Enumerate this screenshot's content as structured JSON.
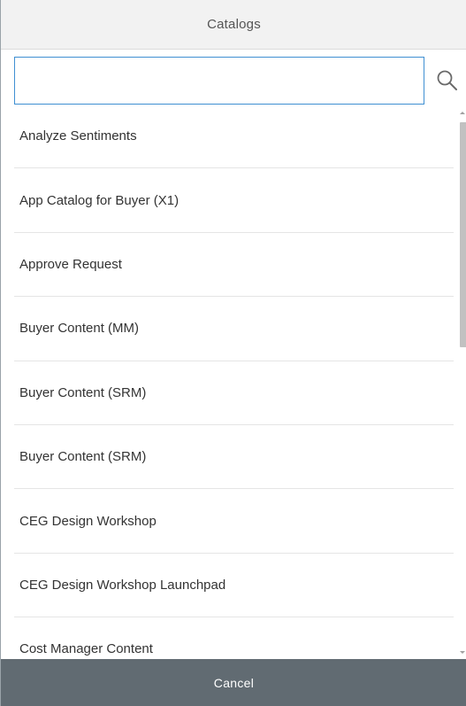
{
  "dialog": {
    "title": "Catalogs"
  },
  "search": {
    "value": "",
    "placeholder": "",
    "icon": "search-icon"
  },
  "catalogs": {
    "items": [
      {
        "label": "Analyze Sentiments"
      },
      {
        "label": "App Catalog for Buyer (X1)"
      },
      {
        "label": "Approve Request"
      },
      {
        "label": "Buyer Content (MM)"
      },
      {
        "label": "Buyer Content (SRM)"
      },
      {
        "label": "Buyer Content (SRM)"
      },
      {
        "label": "CEG Design Workshop"
      },
      {
        "label": "CEG Design Workshop Launchpad"
      },
      {
        "label": "Cost Manager Content"
      }
    ]
  },
  "footer": {
    "cancel_label": "Cancel"
  },
  "colors": {
    "header_bg": "#f2f2f2",
    "footer_bg": "#616b72",
    "input_border": "#3f8fd2",
    "text": "#333333"
  }
}
